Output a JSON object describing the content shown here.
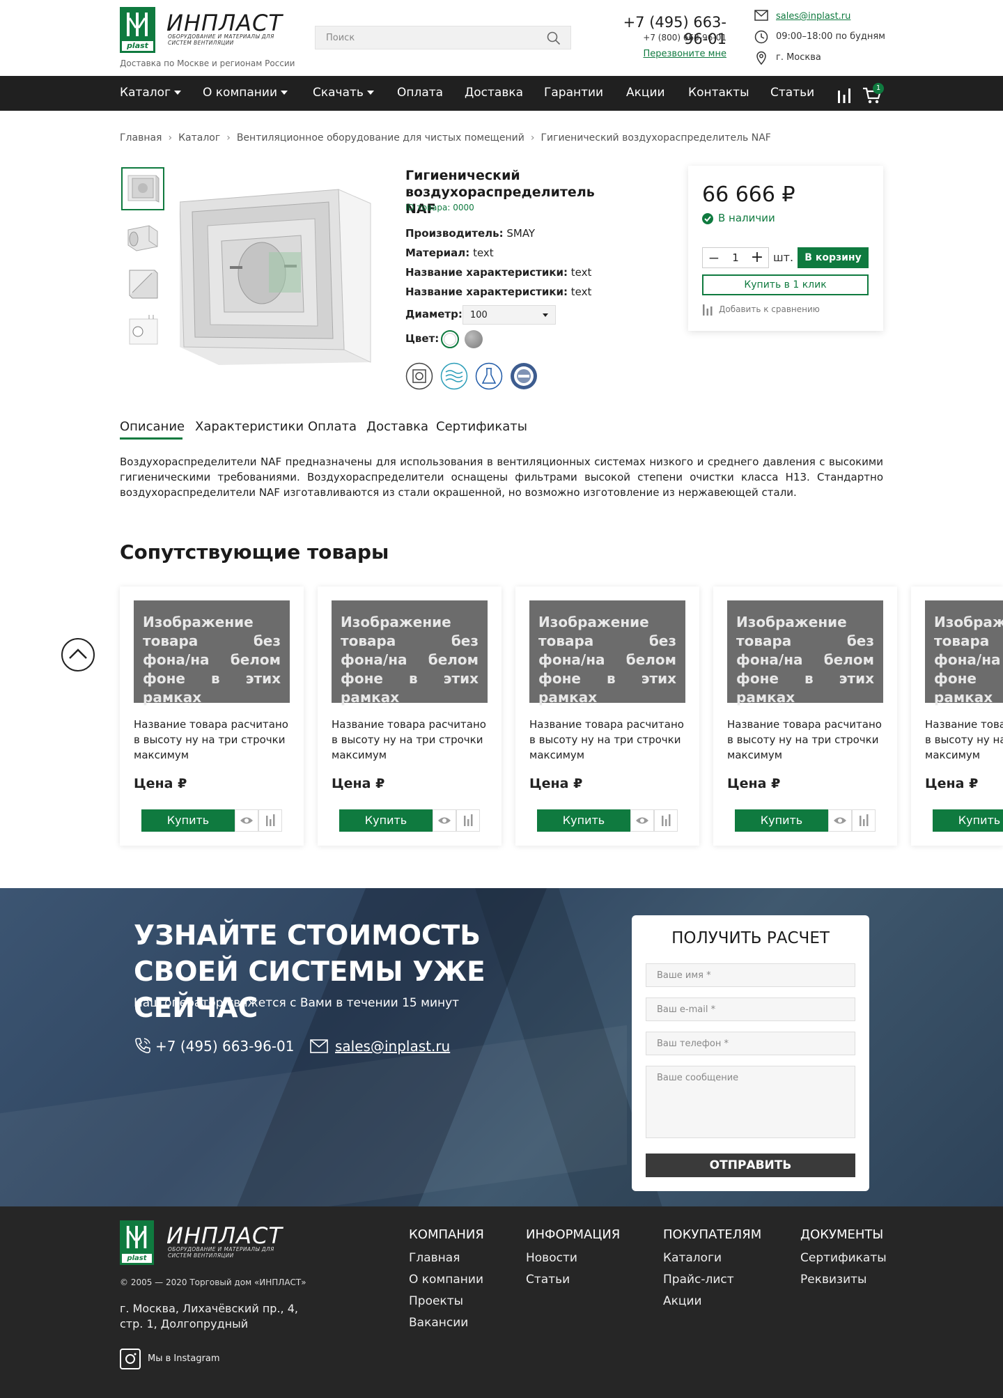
{
  "header": {
    "logo_name": "ИНПЛАСТ",
    "logo_badge": "plast",
    "logo_tagline": "Оборудование и материалы для систем вентиляции",
    "delivery_note": "Доставка по Москве и регионам России",
    "search_placeholder": "Поиск",
    "phone_main": "+7 (495) 663-96-01",
    "phone_sub": "+7 (800) 663-96-01",
    "callback": "Перезвоните мне",
    "email": "sales@inplast.ru",
    "hours": "09:00–18:00 по будням",
    "city": "г. Москва",
    "cart_count": "1"
  },
  "nav": {
    "items": [
      {
        "label": "Каталог",
        "dropdown": true
      },
      {
        "label": "О компании",
        "dropdown": true
      },
      {
        "label": "Скачать",
        "dropdown": true
      },
      {
        "label": "Оплата",
        "dropdown": false
      },
      {
        "label": "Доставка",
        "dropdown": false
      },
      {
        "label": "Гарантии",
        "dropdown": false
      },
      {
        "label": "Акции",
        "dropdown": false
      },
      {
        "label": "Контакты",
        "dropdown": false
      },
      {
        "label": "Статьи",
        "dropdown": false
      }
    ]
  },
  "breadcrumb": [
    "Главная",
    "Каталог",
    "Вентиляционное оборудование для чистых помещений",
    "Гигиенический воздухораспределитель NAF"
  ],
  "product": {
    "title": "Гигиенический воздухораспределитель NAF",
    "id_label": "ID товара:",
    "id_value": "0000",
    "specs": [
      {
        "label": "Производитель:",
        "value": "SMAY"
      },
      {
        "label": "Материал:",
        "value": "text"
      },
      {
        "label": "Название характеристики:",
        "value": "text"
      },
      {
        "label": "Название характеристики:",
        "value": "text"
      }
    ],
    "diameter_label": "Диаметр:",
    "diameter_value": "100",
    "color_label": "Цвет:",
    "colors": [
      "#ffffff",
      "#8a8a8a"
    ],
    "accent_color": "#0f7a3f"
  },
  "buybox": {
    "price": "66 666 ₽",
    "stock": "В наличии",
    "qty": "1",
    "unit": "шт.",
    "cart_button": "В корзину",
    "oneclick_button": "Купить в 1 клик",
    "compare": "Добавить к сравнению"
  },
  "tabs": [
    "Описание",
    "Характеристики",
    "Оплата",
    "Доставка",
    "Сертификаты"
  ],
  "description": "Воздухораспределители NAF предназначены для использования в вентиляционных системах низкого и среднего давления с высокими гигиеническими требованиями. Воздухораспределители оснащены фильтрами высокой степени очистки класса H13. Стандартно воздухораспределители NAF изготавливаются из стали окрашенной, но возможно изготовление из нержавеющей стали.",
  "related": {
    "title": "Сопутствующие товары",
    "cards": [
      {
        "placeholder": "Изображение товара без фона/на белом фоне в этих рамках",
        "name": "Название товара расчитано в высоту ну на три строчки максимум",
        "price": "Цена ₽",
        "buy": "Купить"
      },
      {
        "placeholder": "Изображение товара без фона/на белом фоне в этих рамках",
        "name": "Название товара расчитано в высоту ну на три строчки максимум",
        "price": "Цена ₽",
        "buy": "Купить"
      },
      {
        "placeholder": "Изображение товара без фона/на белом фоне в этих рамках",
        "name": "Название товара расчитано в высоту ну на три строчки максимум",
        "price": "Цена ₽",
        "buy": "Купить"
      },
      {
        "placeholder": "Изображение товара без фона/на белом фоне в этих рамках",
        "name": "Название товара расчитано в высоту ну на три строчки максимум",
        "price": "Цена ₽",
        "buy": "Купить"
      },
      {
        "placeholder": "Изображение товара без фона/на белом фоне в этих рамках",
        "name": "Название товара расчитано в высоту ну на три строчки максимум",
        "price": "Цена ₽",
        "buy": "Купить"
      }
    ]
  },
  "cta": {
    "title": "УЗНАЙТЕ СТОИМОСТЬ СВОЕЙ СИСТЕМЫ УЖЕ СЕЙЧАС",
    "subtitle": "Наш оператор свяжется с Вами в течении 15 минут",
    "phone": "+7 (495) 663-96-01",
    "email": "sales@inplast.ru",
    "form": {
      "title": "ПОЛУЧИТЬ РАСЧЕТ",
      "name_placeholder": "Ваше имя  *",
      "email_placeholder": "Ваш e-mail  *",
      "phone_placeholder": "Ваш телефон  *",
      "message_placeholder": "Ваше сообщение",
      "submit": "ОТПРАВИТЬ"
    }
  },
  "footer": {
    "copyright": "© 2005 — 2020 Торговый дом «ИНПЛАСТ»",
    "address": "г. Москва, Лихачёвский пр., 4, стр. 1, Долгопрудный",
    "instagram": "Мы в Instagram",
    "columns": [
      {
        "title": "КОМПАНИЯ",
        "links": [
          "Главная",
          "О компании",
          "Проекты",
          "Вакансии"
        ]
      },
      {
        "title": "ИНФОРМАЦИЯ",
        "links": [
          "Новости",
          "Статьи"
        ]
      },
      {
        "title": "ПОКУПАТЕЛЯМ",
        "links": [
          "Каталоги",
          "Прайс-лист",
          "Акции"
        ]
      },
      {
        "title": "ДОКУМЕНТЫ",
        "links": [
          "Сертификаты",
          "Реквизиты"
        ]
      }
    ]
  }
}
